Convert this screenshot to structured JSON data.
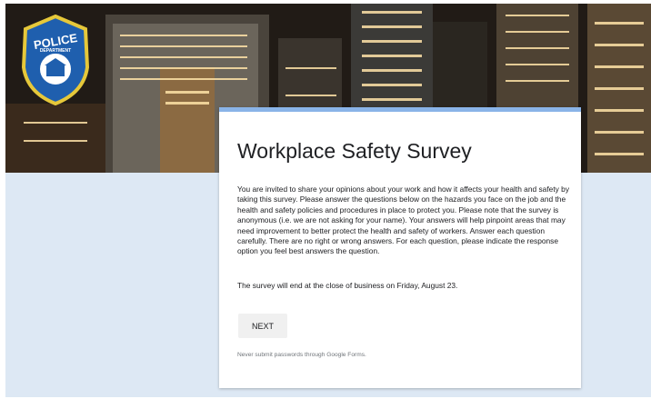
{
  "header": {
    "badge": {
      "top_text": "POLICE",
      "band_text": "DEPARTMENT"
    }
  },
  "form": {
    "title": "Workplace Safety Survey",
    "description": "You are invited to share your opinions about your work and how it affects your health and safety by taking this survey. Please answer the questions below on the hazards you face on the job and the health and safety policies and procedures in place to protect you. Please note that the survey is anonymous (i.e. we are not asking for your name). Your answers will help pinpoint areas that may need improvement to better protect the health and safety of workers. Answer each question carefully. There are no right or wrong answers. For each question, please indicate the response option you feel best answers the question.",
    "end_note": "The survey will end at the close of business on Friday, August 23.",
    "next_label": "NEXT",
    "footer_note": "Never submit passwords through Google Forms."
  },
  "colors": {
    "page_background": "#dde8f4",
    "card_accent": "#8ab4e8",
    "badge_fill": "#1f5fae",
    "badge_border": "#e6c83a"
  },
  "icons": [
    "police-badge-icon"
  ]
}
